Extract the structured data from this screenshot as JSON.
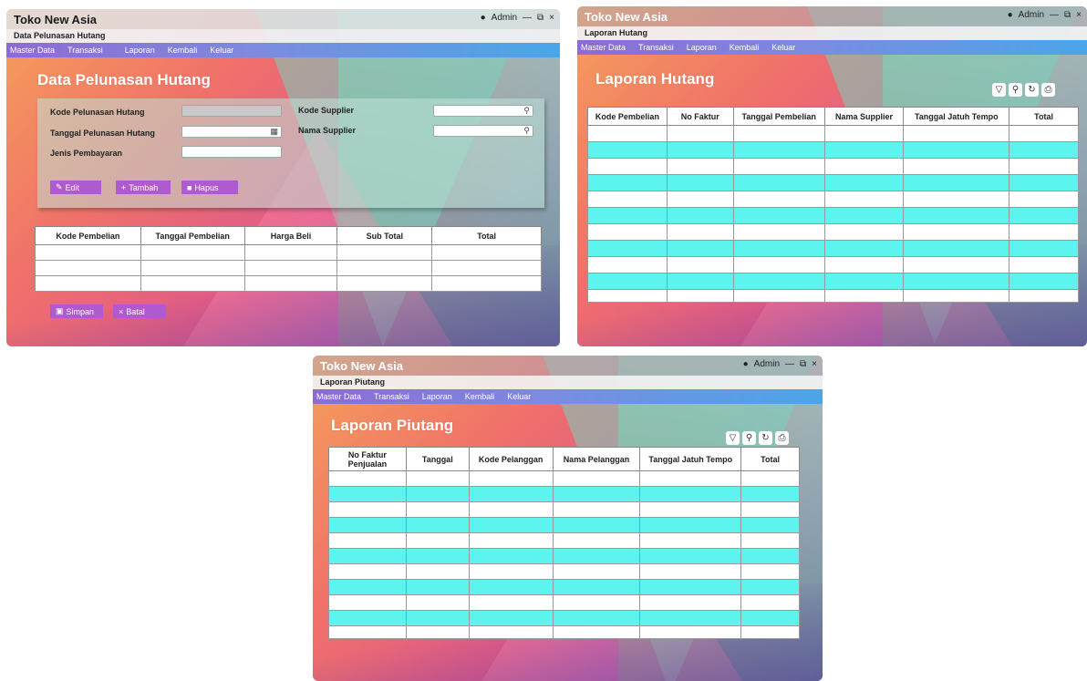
{
  "window1": {
    "app_title": "Toko New Asia",
    "user": "Admin",
    "subtitle": "Data Pelunasan Hutang",
    "menu": [
      "Master Data",
      "Transaksi",
      "Laporan",
      "Kembali",
      "Keluar"
    ],
    "page_title": "Data Pelunasan Hutang",
    "form": {
      "kode_label": "Kode Pelunasan Hutang",
      "tanggal_label": "Tanggal Pelunasan Hutang",
      "jenis_label": "Jenis Pembayaran",
      "supplier_kode_label": "Kode Supplier",
      "supplier_nama_label": "Nama Supplier"
    },
    "buttons": {
      "edit": "Edit",
      "tambah": "Tambah",
      "hapus": "Hapus",
      "simpan": "Simpan",
      "batal": "Batal"
    },
    "table_headers": [
      "Kode Pembelian",
      "Tanggal Pembelian",
      "Harga Beli",
      "Sub Total",
      "Total"
    ]
  },
  "window2": {
    "app_title": "Toko New Asia",
    "user": "Admin",
    "subtitle": "Laporan Hutang",
    "menu": [
      "Master Data",
      "Transaksi",
      "Laporan",
      "Kembali",
      "Keluar"
    ],
    "page_title": "Laporan Hutang",
    "table_headers": [
      "Kode Pembelian",
      "No Faktur",
      "Tanggal Pembelian",
      "Nama Supplier",
      "Tanggal Jatuh Tempo",
      "Total"
    ]
  },
  "window3": {
    "app_title": "Toko New Asia",
    "user": "Admin",
    "subtitle": "Laporan Piutang",
    "menu": [
      "Master Data",
      "Transaksi",
      "Laporan",
      "Kembali",
      "Keluar"
    ],
    "page_title": "Laporan Piutang",
    "table_headers": [
      "No Faktur Penjualan",
      "Tanggal",
      "Kode Pelanggan",
      "Nama Pelanggan",
      "Tanggal Jatuh Tempo",
      "Total"
    ]
  },
  "colors": {
    "accent_purple": "#b05ad0",
    "row_cyan": "#5df3ee",
    "menu_blue": "#4aa6e8"
  }
}
